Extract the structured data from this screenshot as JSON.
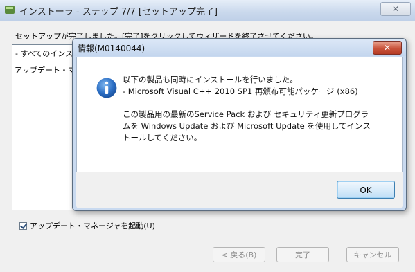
{
  "wizard": {
    "title": "インストーラ - ステップ 7/7 [セットアップ完了]",
    "close_glyph": "✕",
    "instruction": "セットアップが完了しました。[完了]をクリックしてウィザードを終了させてください。",
    "tree_items": [
      "- すべてのインストール",
      "アップデート・マネージャ"
    ],
    "checkbox_label": "アップデート・マネージャを起動(U)",
    "checkbox_checked": true,
    "buttons": {
      "back": "< 戻る(B)",
      "finish": "完了",
      "cancel": "キャンセル"
    }
  },
  "dialog": {
    "title": "情報(M0140044)",
    "close_glyph": "✕",
    "icon": "info-icon",
    "message_lines": [
      "以下の製品も同時にインストールを行いました。",
      " - Microsoft Visual C++ 2010 SP1 再頒布可能パッケージ (x86)",
      "",
      "この製品用の最新のService Pack および セキュリティ更新プログラ",
      "ムを Windows Update および Microsoft Update を使用してインス",
      "トールしてください。"
    ],
    "ok_label": "OK"
  },
  "colors": {
    "info_icon": "#1f5fb5",
    "close_button": "#c9543c"
  }
}
